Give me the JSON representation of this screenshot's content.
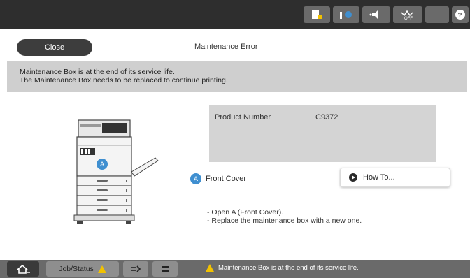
{
  "dialog": {
    "close_label": "Close",
    "title": "Maintenance Error",
    "message_line1": "Maintenance Box is at the end of its service life.",
    "message_line2": "The Maintenance Box needs to be replaced to continue printing."
  },
  "product": {
    "label": "Product Number",
    "value": "C9372"
  },
  "diagram": {
    "marker": "A"
  },
  "legend": {
    "badge": "A",
    "label": "Front Cover"
  },
  "howto": {
    "label": "How To..."
  },
  "steps": [
    "- Open A (Front Cover).",
    "- Replace the maintenance box with a new one."
  ],
  "bottombar": {
    "job_status_label": "Job/Status",
    "status_message": "Maintenance Box is at the end of its service life."
  },
  "colors": {
    "accent_blue": "#3f8fd0",
    "warning_yellow": "#f2c200"
  },
  "icons": {
    "topbar": [
      "paper-setting-icon",
      "ink-status-icon",
      "sound-icon",
      "wifi-off-icon",
      "sleep-icon",
      "help-icon"
    ],
    "bottombar": [
      "home-icon",
      "warning-icon",
      "job-list-icon",
      "menu-icon"
    ]
  }
}
